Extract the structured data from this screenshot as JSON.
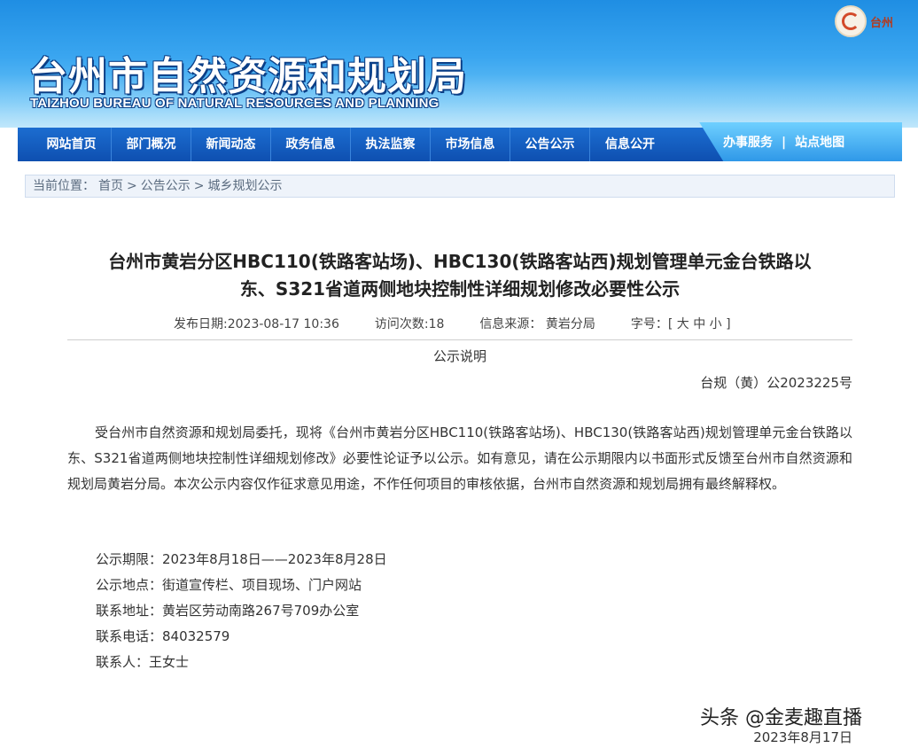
{
  "header": {
    "title": "台州市自然资源和规划局",
    "subtitle": "TAIZHOU BUREAU OF NATURAL RESOURCES AND PLANNING",
    "logo_text": "台州",
    "logo_icon": "taizhou-logo-icon"
  },
  "nav": {
    "items": [
      "网站首页",
      "部门概况",
      "新闻动态",
      "政务信息",
      "执法监察",
      "市场信息",
      "公告公示",
      "信息公开"
    ],
    "right_links": [
      "办事服务",
      "站点地图"
    ],
    "separator": "|"
  },
  "breadcrumb": {
    "label": "当前位置：",
    "items": [
      "首页",
      "公告公示",
      "城乡规划公示"
    ],
    "separator": ">"
  },
  "article": {
    "title_line1": "台州市黄岩分区HBC110(铁路客站场)、HBC130(铁路客站西)规划管理单元金台铁路以",
    "title_line2": "东、S321省道两侧地块控制性详细规划修改必要性公示",
    "publish_date": "发布日期:2023-08-17  10:36",
    "visits": "访问次数:18",
    "source": "信息来源：  黄岩分局",
    "font_size_label": "字号：",
    "font_size_options": "[ 大 中 小 ]",
    "notice_label": "公示说明",
    "doc_number": "台规（黄）公2023225号",
    "body": "受台州市自然资源和规划局委托，现将《台州市黄岩分区HBC110(铁路客站场)、HBC130(铁路客站西)规划管理单元金台铁路以东、S321省道两侧地块控制性详细规划修改》必要性论证予以公示。如有意见，请在公示期限内以书面形式反馈至台州市自然资源和规划局黄岩分局。本次公示内容仅作征求意见用途，不作任何项目的审核依据，台州市自然资源和规划局拥有最终解释权。",
    "info": [
      "公示期限：2023年8月18日——2023年8月28日",
      "公示地点：街道宣传栏、项目现场、门户网站",
      "联系地址：黄岩区劳动南路267号709办公室",
      "联系电话：84032579",
      "联系人：王女士"
    ],
    "watermark": "头条 @金麦趣直播",
    "sign_date": "2023年8月17日"
  },
  "colors": {
    "banner": "#2f9cec",
    "nav": "#0e4fb0",
    "nav_right": "#4bb8f7"
  }
}
